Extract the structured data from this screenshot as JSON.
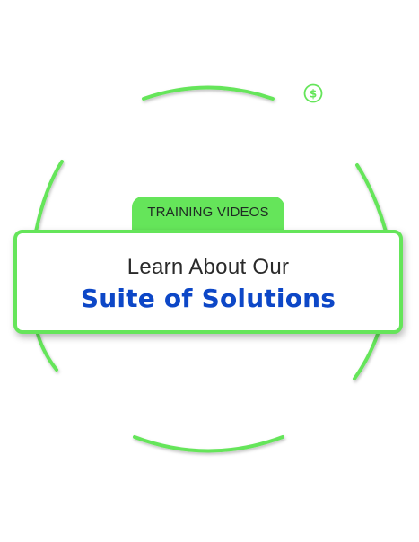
{
  "badge": {
    "label": "TRAINING VIDEOS"
  },
  "headline": {
    "line1": "Learn About Our",
    "line2": "Suite of Solutions"
  },
  "icons": {
    "badge_icon": "dollar-icon"
  },
  "colors": {
    "accent_green": "#65e55a",
    "headline_blue": "#0d47c7",
    "text_dark": "#2a2a2a"
  }
}
